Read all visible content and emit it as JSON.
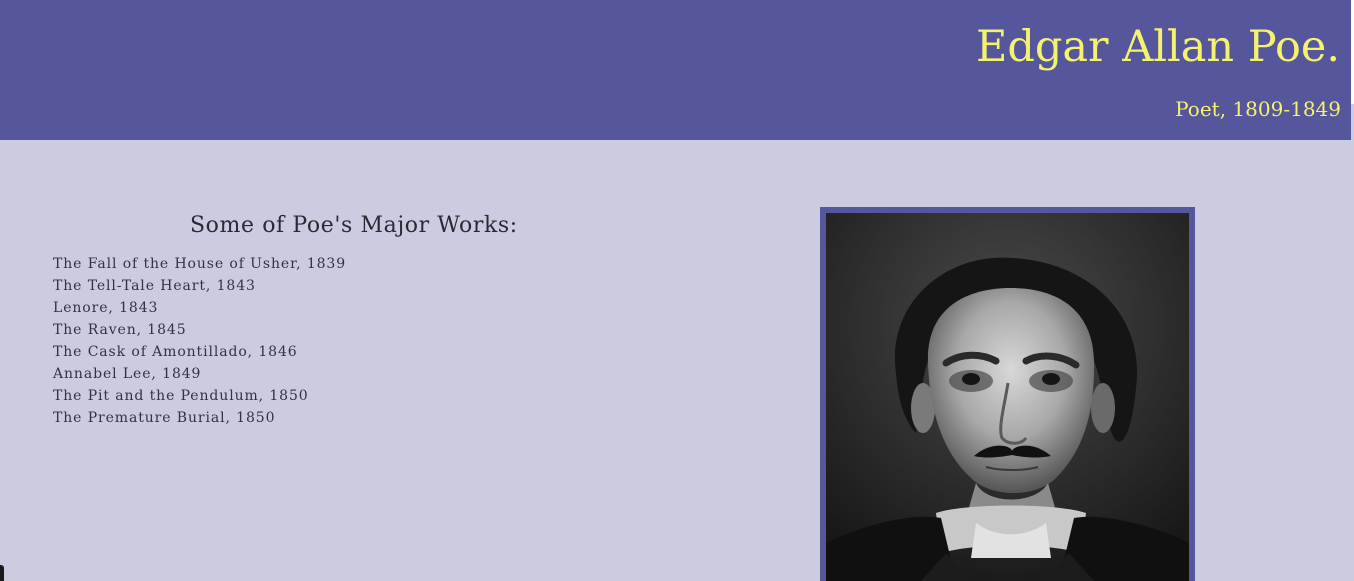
{
  "header": {
    "title": "Edgar Allan Poe.",
    "subtitle": "Poet, 1809-1849",
    "background_color": "#55569b",
    "text_color": "#f4f26e"
  },
  "works": {
    "heading": "Some of Poe's Major Works:",
    "items": [
      "The Fall of the House of Usher, 1839",
      "The Tell-Tale Heart, 1843",
      "Lenore, 1843",
      "The Raven, 1845",
      "The Cask of Amontillado, 1846",
      "Annabel Lee, 1849",
      "The Pit and the Pendulum, 1850",
      "The Premature Burial, 1850"
    ]
  },
  "portrait": {
    "subject": "Edgar Allan Poe portrait photograph",
    "frame_color": "#55569b"
  },
  "page": {
    "background_color": "#cccce0"
  }
}
